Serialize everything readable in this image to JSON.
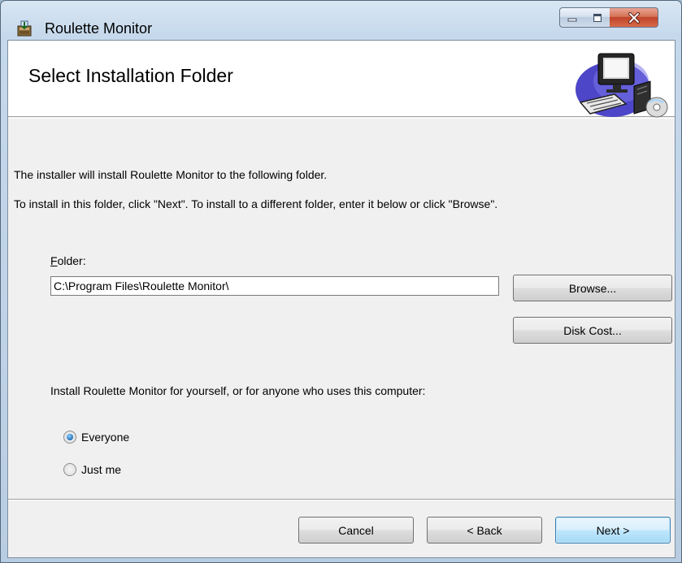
{
  "window": {
    "title": "Roulette Monitor",
    "controls": {
      "minimize": "minimize",
      "maximize": "maximize",
      "close": "close"
    }
  },
  "banner": {
    "title": "Select Installation Folder",
    "icon": "computer-setup-icon"
  },
  "body": {
    "intro_line_1": "The installer will install Roulette Monitor to the following folder.",
    "intro_line_2": "To install in this folder, click \"Next\". To install to a different folder, enter it below or click \"Browse\".",
    "folder_label_mnemonic": "F",
    "folder_label_rest": "older:",
    "folder_value": "C:\\Program Files\\Roulette Monitor\\",
    "browse_label": "Browse...",
    "disk_cost_label": "Disk Cost...",
    "scope_prompt": "Install Roulette Monitor for yourself, or for anyone who uses this computer:",
    "options": [
      {
        "label": "Everyone",
        "selected": true
      },
      {
        "label": "Just me",
        "selected": false
      }
    ]
  },
  "footer": {
    "cancel_label": "Cancel",
    "back_label": "< Back",
    "next_label": "Next >"
  },
  "colors": {
    "title_bar": "#c5d8ec",
    "client_background": "#f0f0f0",
    "close_button": "#c0432a",
    "default_button_border": "#3c7fb1"
  }
}
